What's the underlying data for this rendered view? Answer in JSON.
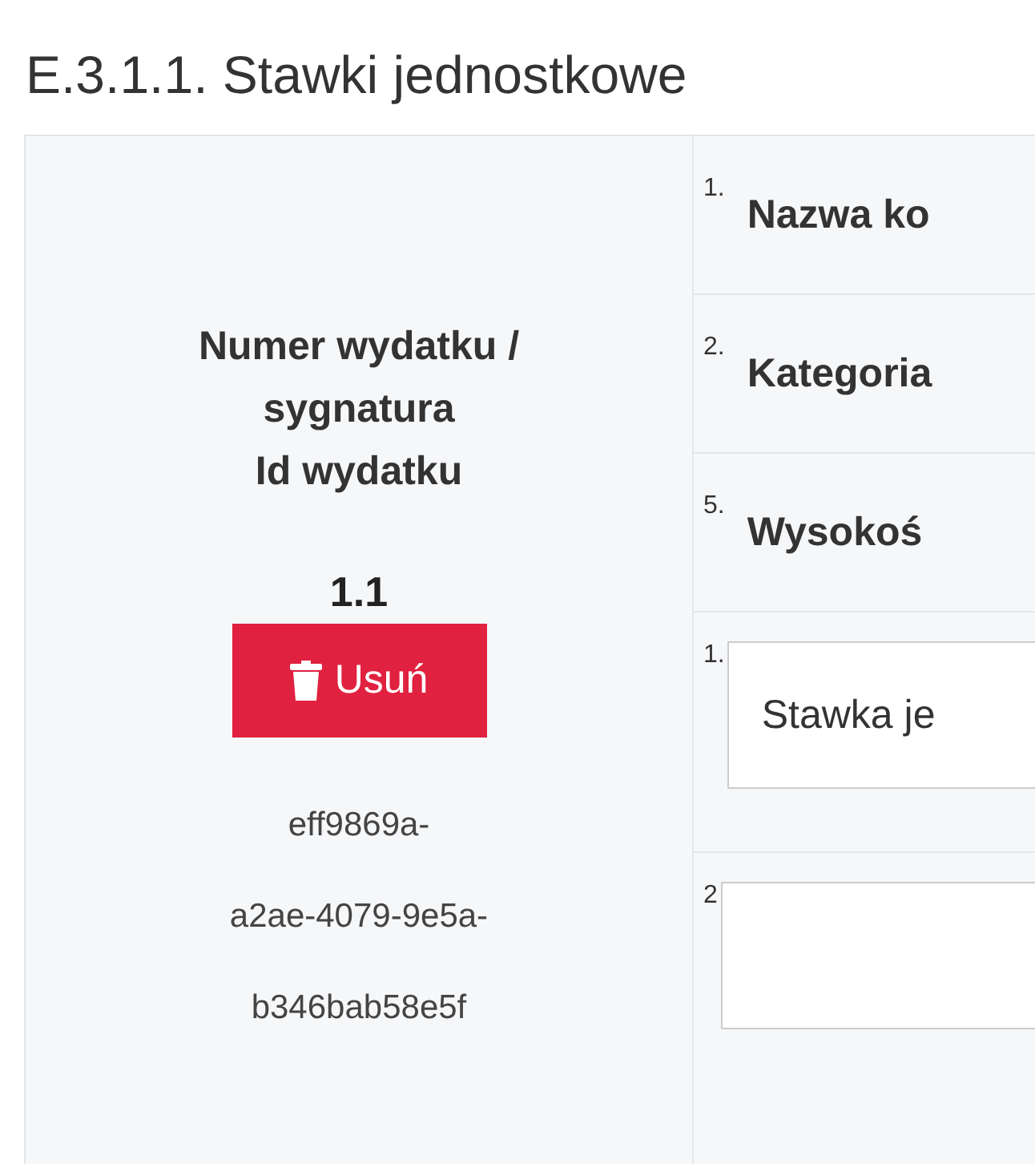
{
  "title": "E.3.1.1. Stawki jednostkowe",
  "expense": {
    "header_lines": [
      "Numer wydatku /",
      "sygnatura",
      "Id wydatku"
    ],
    "number": "1.1",
    "delete_button": "Usuń",
    "id_lines": [
      "eff9869a-",
      "a2ae-4079-9e5a-",
      "b346bab58e5f"
    ]
  },
  "columns": [
    {
      "index": "1.",
      "label": "Nazwa ko"
    },
    {
      "index": "2.",
      "label": "Kategoria"
    },
    {
      "index": "5.",
      "label": "Wysokoś"
    }
  ],
  "fields": [
    {
      "index": "1.",
      "value": "Stawka je"
    },
    {
      "index": "2"
    }
  ]
}
